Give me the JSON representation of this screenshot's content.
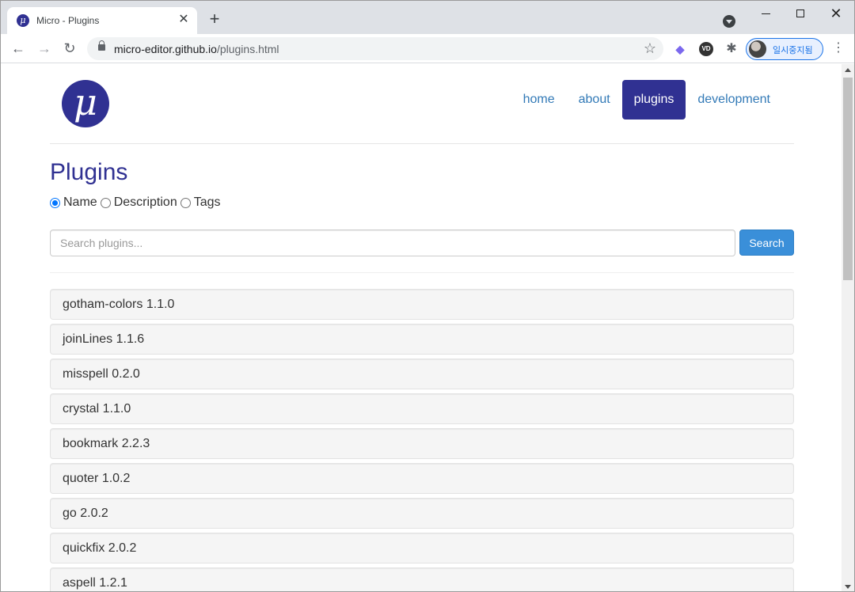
{
  "browser": {
    "tab_title": "Micro - Plugins",
    "url_host": "micro-editor.github.io",
    "url_path": "/plugins.html",
    "profile_label": "일시중지됨"
  },
  "site": {
    "logo_glyph": "μ",
    "nav": [
      {
        "label": "home",
        "active": false
      },
      {
        "label": "about",
        "active": false
      },
      {
        "label": "plugins",
        "active": true
      },
      {
        "label": "development",
        "active": false
      }
    ],
    "accent_color": "#303192"
  },
  "main": {
    "title": "Plugins",
    "filters": [
      {
        "label": "Name",
        "checked": true
      },
      {
        "label": "Description",
        "checked": false
      },
      {
        "label": "Tags",
        "checked": false
      }
    ],
    "search_placeholder": "Search plugins...",
    "search_button": "Search",
    "plugins": [
      "gotham-colors 1.1.0",
      "joinLines 1.1.6",
      "misspell 0.2.0",
      "crystal 1.1.0",
      "bookmark 2.2.3",
      "quoter 1.0.2",
      "go 2.0.2",
      "quickfix 2.0.2",
      "aspell 1.2.1"
    ]
  }
}
